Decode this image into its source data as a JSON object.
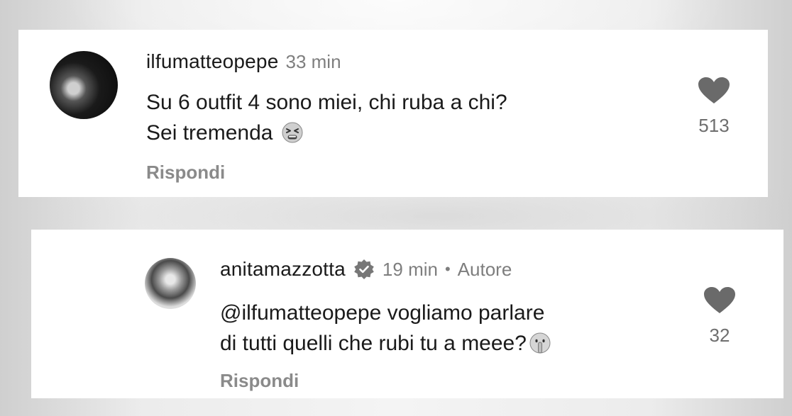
{
  "comments": [
    {
      "username": "ilfumatteopepe",
      "time": "33 min",
      "line1": "Su 6 outfit 4 sono miei, chi ruba a chi?",
      "line2": "Sei tremenda",
      "emoji_icon": "tired-face-icon",
      "reply_label": "Rispondi",
      "likes": "513"
    },
    {
      "username": "anitamazzotta",
      "verified": true,
      "time": "19 min",
      "separator": "•",
      "author_label": "Autore",
      "mention": "@ilfumatteopepe",
      "line1_rest": " vogliamo parlare",
      "line2": "di tutti quelli che rubi tu a meee?",
      "emoji_icon": "shushing-face-icon",
      "reply_label": "Rispondi",
      "likes": "32"
    }
  ],
  "colors": {
    "text": "#1a1a1a",
    "muted": "#7e7e7e",
    "heart": "#6a6a6a"
  }
}
